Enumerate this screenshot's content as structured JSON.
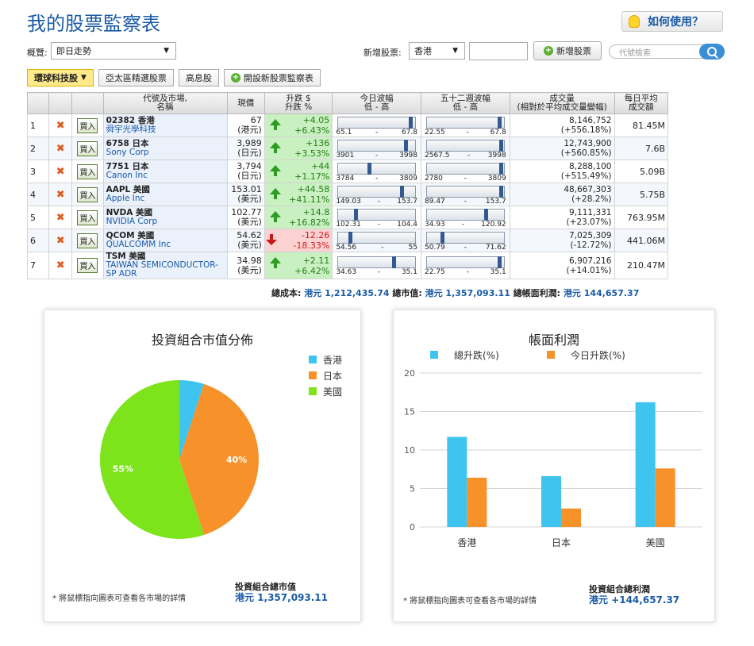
{
  "title": "我的股票監察表",
  "help": {
    "label": "如何使用？"
  },
  "overview": {
    "label": "概覽:",
    "selected": "即日走勢"
  },
  "add_stock": {
    "label": "新增股票:",
    "market": "香港",
    "button": "新增股票"
  },
  "search": {
    "placeholder": "代號檢索"
  },
  "tabs": [
    {
      "label": "環球科技股",
      "active": true
    },
    {
      "label": "亞太區精選股票"
    },
    {
      "label": "高息股"
    },
    {
      "label": "開設新股票監察表"
    }
  ],
  "table": {
    "headers": {
      "name": "代號及市場,\n名稱",
      "price": "現價",
      "change": "升跌 $\n升跌 %",
      "day_range": "今日波幅\n低 - 高",
      "week52_range": "五十二週波幅\n低 - 高",
      "volume": "成交量\n(相對於平均成交量變幅)",
      "avg_turnover": "每日平均\n成交額"
    },
    "buy_label": "買入",
    "rows": [
      {
        "idx": "1",
        "code": "02382 香港",
        "name": "舜宇光學科技",
        "price": "67",
        "cur": "(港元)",
        "chg": "+4.05",
        "pct": "+6.43%",
        "dir": "up",
        "day_low": "65.1",
        "day_high": "67.8",
        "day_pos": 0.97,
        "w_low": "22.55",
        "w_high": "67.8",
        "w_pos": 0.97,
        "vol": "8,146,752",
        "vol_rel": "(+556.18%)",
        "avg": "81.45M"
      },
      {
        "idx": "2",
        "code": "6758 日本",
        "name": "Sony Corp",
        "price": "3,989",
        "cur": "(日元)",
        "chg": "+136",
        "pct": "+3.53%",
        "dir": "up",
        "day_low": "3901",
        "day_high": "3998",
        "day_pos": 0.9,
        "w_low": "2567.5",
        "w_high": "3998",
        "w_pos": 0.99,
        "vol": "12,743,900",
        "vol_rel": "(+560.85%)",
        "avg": "7.6B"
      },
      {
        "idx": "3",
        "code": "7751 日本",
        "name": "Canon Inc",
        "price": "3,794",
        "cur": "(日元)",
        "chg": "+44",
        "pct": "+1.17%",
        "dir": "up",
        "day_low": "3784",
        "day_high": "3809",
        "day_pos": 0.4,
        "w_low": "2780",
        "w_high": "3809",
        "w_pos": 0.99,
        "vol": "8,288,100",
        "vol_rel": "(+515.49%)",
        "avg": "5.09B"
      },
      {
        "idx": "4",
        "code": "AAPL 美國",
        "name": "Apple Inc",
        "price": "153.01",
        "cur": "(美元)",
        "chg": "+44.58",
        "pct": "+41.11%",
        "dir": "up",
        "day_low": "149.03",
        "day_high": "153.7",
        "day_pos": 0.85,
        "w_low": "89.47",
        "w_high": "153.7",
        "w_pos": 0.99,
        "vol": "48,667,303",
        "vol_rel": "(+28.2%)",
        "avg": "5.75B"
      },
      {
        "idx": "5",
        "code": "NVDA 美國",
        "name": "NVIDIA Corp",
        "price": "102.77",
        "cur": "(美元)",
        "chg": "+14.8",
        "pct": "+16.82%",
        "dir": "up",
        "day_low": "102.31",
        "day_high": "104.4",
        "day_pos": 0.22,
        "w_low": "34.93",
        "w_high": "120.92",
        "w_pos": 0.79,
        "vol": "9,111,331",
        "vol_rel": "(+23.07%)",
        "avg": "763.95M"
      },
      {
        "idx": "6",
        "code": "QCOM 美國",
        "name": "QUALCOMM Inc",
        "price": "54.62",
        "cur": "(美元)",
        "chg": "-12.26",
        "pct": "-18.33%",
        "dir": "down",
        "day_low": "54.56",
        "day_high": "55",
        "day_pos": 0.14,
        "w_low": "50.79",
        "w_high": "71.62",
        "w_pos": 0.18,
        "vol": "7,025,309",
        "vol_rel": "(-12.72%)",
        "avg": "441.06M"
      },
      {
        "idx": "7",
        "code": "TSM 美國",
        "name": "TAIWAN SEMICONDUCTOR-SP ADR",
        "price": "34.98",
        "cur": "(美元)",
        "chg": "+2.11",
        "pct": "+6.42%",
        "dir": "up",
        "day_low": "34.63",
        "day_high": "35.1",
        "day_pos": 0.74,
        "w_low": "22.75",
        "w_high": "35.1",
        "w_pos": 0.97,
        "vol": "6,907,216",
        "vol_rel": "(+14.01%)",
        "avg": "210.47M"
      }
    ]
  },
  "totals": {
    "cost_label": "總成本:",
    "cost": "港元 1,212,435.74",
    "value_label": "總市值:",
    "value": "港元 1,357,093.11",
    "pl_label": "總帳面利潤:",
    "pl": "港元 144,657.37"
  },
  "pie_panel": {
    "title": "投資組合市值分佈",
    "note": "* 將鼠標指向圖表可查看各市場的詳情",
    "sum_label": "投資組合總市值",
    "sum_value": "港元 1,357,093.11"
  },
  "bar_panel": {
    "title": "帳面利潤",
    "note": "* 將鼠標指向圖表可查看各市場的詳情",
    "sum_label": "投資組合總利潤",
    "sum_value": "港元 +144,657.37"
  },
  "colors": {
    "hk": "#3ec4ef",
    "jp": "#f7922a",
    "us": "#7de31b",
    "accent": "#1a5aa6"
  },
  "chart_data": [
    {
      "type": "pie",
      "title": "投資組合市值分佈",
      "labels": [
        "香港",
        "日本",
        "美國"
      ],
      "values": [
        5,
        40,
        55
      ],
      "shown_labels": [
        "",
        "40%",
        "55%"
      ],
      "legend": "top-right"
    },
    {
      "type": "bar",
      "title": "帳面利潤",
      "categories": [
        "香港",
        "日本",
        "美國"
      ],
      "series": [
        {
          "name": "總升跌(%)",
          "values": [
            11.7,
            6.6,
            16.2
          ]
        },
        {
          "name": "今日升跌(%)",
          "values": [
            6.4,
            2.4,
            7.6
          ]
        }
      ],
      "ylim": [
        0,
        20
      ],
      "yticks": [
        "0",
        "5",
        "10",
        "15",
        "20"
      ],
      "grid": true,
      "legend": "top"
    }
  ]
}
